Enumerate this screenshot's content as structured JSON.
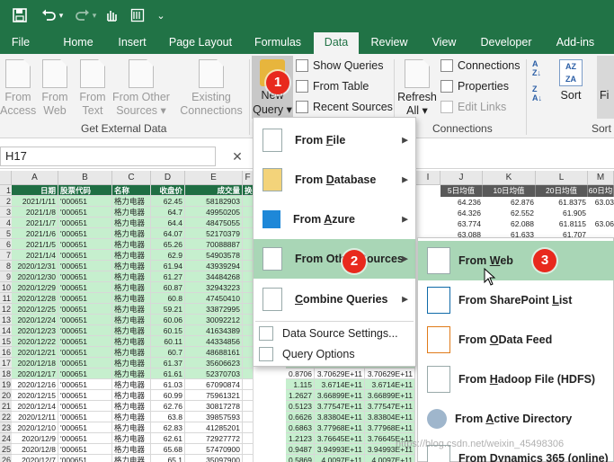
{
  "quick_access": {
    "save_icon": "save-icon",
    "undo_icon": "undo-icon",
    "redo_icon": "redo-icon",
    "touch_icon": "touch-mode-icon",
    "form_icon": "form-icon",
    "more": "⌄"
  },
  "tabs": [
    "File",
    "Home",
    "Insert",
    "Page Layout",
    "Formulas",
    "Data",
    "Review",
    "View",
    "Developer",
    "Add-ins"
  ],
  "active_tab": "Data",
  "ribbon": {
    "get_external_data": {
      "label": "Get External Data",
      "buttons": [
        {
          "line1": "From",
          "line2": "Access"
        },
        {
          "line1": "From",
          "line2": "Web"
        },
        {
          "line1": "From",
          "line2": "Text"
        },
        {
          "line1": "From Other",
          "line2": "Sources ▾"
        },
        {
          "line1": "Existing",
          "line2": "Connections"
        }
      ]
    },
    "new_query": {
      "line1": "New",
      "line2": "Query ▾"
    },
    "get_transform": [
      "Show Queries",
      "From Table",
      "Recent Sources"
    ],
    "connections": {
      "label": "Connections",
      "refresh_line1": "Refresh",
      "refresh_line2": "All ▾",
      "items": [
        "Connections",
        "Properties",
        "Edit Links"
      ]
    },
    "sort": {
      "label": "Sort",
      "button": "Sort",
      "filter_partial": "Fi"
    }
  },
  "formula_bar": {
    "name_box": "H17",
    "cancel_symbol": "✕"
  },
  "grid": {
    "columns": [
      "A",
      "B",
      "C",
      "D",
      "E",
      "F",
      "I",
      "J",
      "K",
      "L",
      "M"
    ],
    "headers": [
      "日期",
      "股票代码",
      "名称",
      "收盘价",
      "成交量",
      "换"
    ],
    "rows": [
      {
        "n": "1"
      },
      {
        "n": "2",
        "date": "2021/1/11",
        "code": "'000651",
        "name": "格力电器",
        "close": "62.45",
        "vol": "58182903"
      },
      {
        "n": "3",
        "date": "2021/1/8",
        "code": "'000651",
        "name": "格力电器",
        "close": "64.7",
        "vol": "49950205"
      },
      {
        "n": "4",
        "date": "2021/1/7",
        "code": "'000651",
        "name": "格力电器",
        "close": "64.4",
        "vol": "48475055"
      },
      {
        "n": "5",
        "date": "2021/1/6",
        "code": "'000651",
        "name": "格力电器",
        "close": "64.07",
        "vol": "52170379"
      },
      {
        "n": "6",
        "date": "2021/1/5",
        "code": "'000651",
        "name": "格力电器",
        "close": "65.26",
        "vol": "70088887"
      },
      {
        "n": "7",
        "date": "2021/1/4",
        "code": "'000651",
        "name": "格力电器",
        "close": "62.9",
        "vol": "54903578"
      },
      {
        "n": "8",
        "date": "2020/12/31",
        "code": "'000651",
        "name": "格力电器",
        "close": "61.94",
        "vol": "43939294"
      },
      {
        "n": "9",
        "date": "2020/12/30",
        "code": "'000651",
        "name": "格力电器",
        "close": "61.27",
        "vol": "34484268"
      },
      {
        "n": "10",
        "date": "2020/12/29",
        "code": "'000651",
        "name": "格力电器",
        "close": "60.87",
        "vol": "32943223"
      },
      {
        "n": "11",
        "date": "2020/12/28",
        "code": "'000651",
        "name": "格力电器",
        "close": "60.8",
        "vol": "47450410"
      },
      {
        "n": "12",
        "date": "2020/12/25",
        "code": "'000651",
        "name": "格力电器",
        "close": "59.21",
        "vol": "33872995"
      },
      {
        "n": "13",
        "date": "2020/12/24",
        "code": "'000651",
        "name": "格力电器",
        "close": "60.06",
        "vol": "30092212"
      },
      {
        "n": "14",
        "date": "2020/12/23",
        "code": "'000651",
        "name": "格力电器",
        "close": "60.15",
        "vol": "41634389"
      },
      {
        "n": "15",
        "date": "2020/12/22",
        "code": "'000651",
        "name": "格力电器",
        "close": "60.11",
        "vol": "44334856"
      },
      {
        "n": "16",
        "date": "2020/12/21",
        "code": "'000651",
        "name": "格力电器",
        "close": "60.7",
        "vol": "48688161"
      },
      {
        "n": "17",
        "date": "2020/12/18",
        "code": "'000651",
        "name": "格力电器",
        "close": "61.37",
        "vol": "35606623",
        "f": "0.9710",
        "g": "3.8168E+11",
        "h": "3.6716E+11"
      },
      {
        "n": "18",
        "date": "2020/12/17",
        "code": "'000651",
        "name": "格力电器",
        "close": "61.61",
        "vol": "52370703",
        "f": "0.8706",
        "g": "3.70629E+11",
        "h": "3.70629E+11"
      },
      {
        "n": "19",
        "date": "2020/12/16",
        "code": "'000651",
        "name": "格力电器",
        "close": "61.03",
        "vol": "67090874",
        "f": "1.115",
        "g": "3.6714E+11",
        "h": "3.6714E+11"
      },
      {
        "n": "20",
        "date": "2020/12/15",
        "code": "'000651",
        "name": "格力电器",
        "close": "60.99",
        "vol": "75961321",
        "f": "1.2627",
        "g": "3.66899E+11",
        "h": "3.66899E+11"
      },
      {
        "n": "21",
        "date": "2020/12/14",
        "code": "'000651",
        "name": "格力电器",
        "close": "62.76",
        "vol": "30817278",
        "f": "0.5123",
        "g": "3.77547E+11",
        "h": "3.77547E+11"
      },
      {
        "n": "22",
        "date": "2020/12/11",
        "code": "'000651",
        "name": "格力电器",
        "close": "63.8",
        "vol": "39857593",
        "f": "0.6626",
        "g": "3.83804E+11",
        "h": "3.83804E+11"
      },
      {
        "n": "23",
        "date": "2020/12/10",
        "code": "'000651",
        "name": "格力电器",
        "close": "62.83",
        "vol": "41285201",
        "f": "0.6863",
        "g": "3.77968E+11",
        "h": "3.77968E+11"
      },
      {
        "n": "24",
        "date": "2020/12/9",
        "code": "'000651",
        "name": "格力电器",
        "close": "62.61",
        "vol": "72927772",
        "f": "1.2123",
        "g": "3.76645E+11",
        "h": "3.76645E+11"
      },
      {
        "n": "25",
        "date": "2020/12/8",
        "code": "'000651",
        "name": "格力电器",
        "close": "65.68",
        "vol": "57470900",
        "f": "0.9487",
        "g": "3.94993E+11",
        "h": "3.94993E+11"
      },
      {
        "n": "26",
        "date": "2020/12/7",
        "code": "'000651",
        "name": "格力电器",
        "close": "65.1",
        "vol": "35097900",
        "f": "0.5869",
        "g": "4.0097E+11",
        "h": "4.0097E+11"
      }
    ],
    "right_headers": [
      "5日均值",
      "10日均值",
      "20日均值",
      "60日均"
    ],
    "right_rows": [
      [
        "64.236",
        "62.876",
        "61.8375",
        "63.03"
      ],
      [
        "64.326",
        "62.552",
        "61.905",
        ""
      ],
      [
        "63.774",
        "62.088",
        "61.8115",
        "63.06"
      ],
      [
        "63.088",
        "61.633",
        "61.707",
        ""
      ]
    ]
  },
  "menu_new_query": {
    "items": [
      {
        "pre": "From ",
        "u": "F",
        "post": "ile",
        "arrow": true
      },
      {
        "pre": "From ",
        "u": "D",
        "post": "atabase",
        "arrow": true
      },
      {
        "pre": "From ",
        "u": "A",
        "post": "zure",
        "arrow": true
      },
      {
        "pre": "From Oth",
        "u": "e",
        "post": "r Sources",
        "arrow": true
      },
      {
        "pre": "",
        "u": "C",
        "post": "ombine Queries",
        "arrow": true
      }
    ],
    "small_items": [
      "Data Source Settings...",
      "Query Options"
    ]
  },
  "menu_other_sources": {
    "items": [
      {
        "pre": "From ",
        "u": "W",
        "post": "eb"
      },
      {
        "pre": "From SharePoint ",
        "u": "L",
        "post": "ist"
      },
      {
        "pre": "From ",
        "u": "O",
        "post": "Data Feed"
      },
      {
        "pre": "From ",
        "u": "H",
        "post": "adoop File (HDFS)"
      },
      {
        "pre": "From ",
        "u": "A",
        "post": "ctive Directory"
      },
      {
        "pre": "From Dynamics 365 (online)",
        "u": "",
        "post": ""
      }
    ]
  },
  "step_badges": [
    "1",
    "2",
    "3"
  ],
  "watermark": "https://blog.csdn.net/weixin_45498306"
}
